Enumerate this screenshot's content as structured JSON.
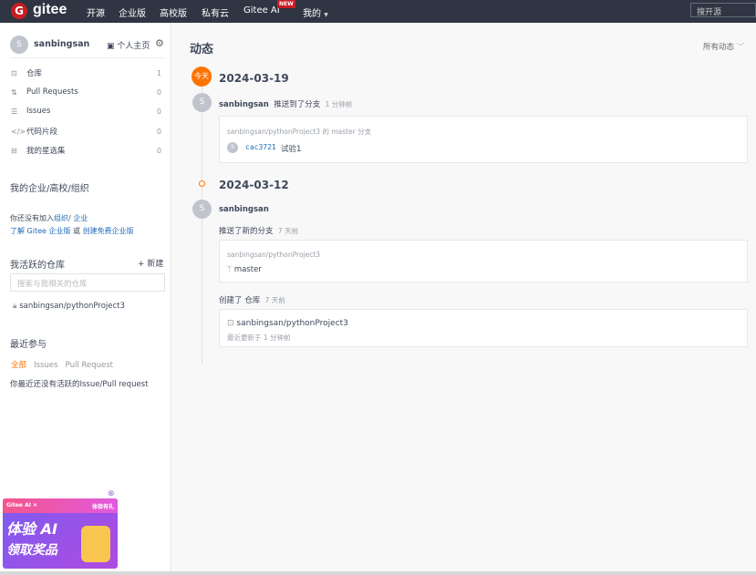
{
  "nav": {
    "logo": "gitee",
    "items": [
      "开源",
      "企业版",
      "高校版",
      "私有云",
      "Gitee AI",
      "我的"
    ],
    "new_badge": "NEW",
    "search_placeholder": "搜开源"
  },
  "sidebar": {
    "username": "sanbingsan",
    "avatar_letter": "S",
    "homepage": "个人主页",
    "items": [
      {
        "label": "仓库",
        "count": "1",
        "icon": "repo-icon"
      },
      {
        "label": "Pull Requests",
        "count": "0",
        "icon": "pull-request-icon"
      },
      {
        "label": "Issues",
        "count": "0",
        "icon": "issues-icon"
      },
      {
        "label": "代码片段",
        "count": "0",
        "icon": "code-icon"
      },
      {
        "label": "我的星选集",
        "count": "0",
        "icon": "collection-icon"
      }
    ],
    "org_title": "我的企业/高校/组织",
    "org_text": "你还没有加入",
    "org_link1": "组织",
    "org_sep": "/",
    "org_link2": "企业",
    "learn": "了解 Gitee 企业版",
    "or": "或",
    "create": "创建免费企业版",
    "repos_title": "我活跃的仓库",
    "new_repo": "新建",
    "repo_search_placeholder": "搜索与我相关的仓库",
    "repo": "sanbingsan/pythonProject3",
    "recent_title": "最近参与",
    "recent_tabs": [
      "全部",
      "Issues",
      "Pull Request"
    ],
    "recent_empty": "你最近还没有活跃的Issue/Pull request"
  },
  "ad": {
    "line1": "Gitee AI",
    "line2": "体验有礼",
    "big1": "体验 AI",
    "big2": "领取奖品"
  },
  "main": {
    "title": "动态",
    "filter": "所有动态",
    "today": "今天",
    "groups": [
      {
        "date": "2024-03-19",
        "user": "sanbingsan",
        "action": "推送到了分支",
        "time": "1 分钟前",
        "card_title": "sanbingsan/pythonProject3 的 master 分支",
        "commit": "cac3721",
        "message": "试验1"
      },
      {
        "date": "2024-03-12",
        "user": "sanbingsan",
        "action1": "推送了新的分支",
        "time1": "7 天前",
        "card1_title": "sanbingsan/pythonProject3",
        "branch": "master",
        "action2": "创建了 仓库",
        "time2": "7 天前",
        "repo": "sanbingsan/pythonProject3",
        "updated": "最近更新于 1 分钟前"
      }
    ]
  },
  "colors": {
    "nav": "#2f3542",
    "accent": "#fe7300",
    "link": "#1e6bb8",
    "brand": "#c71d23"
  }
}
